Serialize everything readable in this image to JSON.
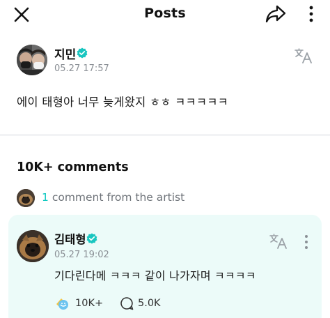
{
  "header": {
    "title": "Posts",
    "close_icon": "close-icon",
    "share_icon": "share-icon",
    "more_icon": "more-vertical-icon"
  },
  "post": {
    "author": "지민",
    "verified_icon": "verified-badge-icon",
    "time": "05.27 17:57",
    "translate_icon": "translate-icon",
    "body": "에이 태형아 너무 늦게왔지 ㅎㅎ ㅋㅋㅋㅋㅋ"
  },
  "comments": {
    "count_label": "10K+ comments",
    "artist_count": "1",
    "artist_label": "comment from the artist"
  },
  "comment": {
    "author": "김태형",
    "time": "05.27 19:02",
    "text": "기다린다메 ㅋㅋㅋ 같이 나가자며 ㅋㅋㅋㅋ",
    "reaction_count": "10K+",
    "reply_count": "5.0K"
  },
  "colors": {
    "accent": "#10c8c0",
    "card_background": "#ecfbf9",
    "verified": "#19c6c0",
    "muted_text": "#8a8f95"
  }
}
